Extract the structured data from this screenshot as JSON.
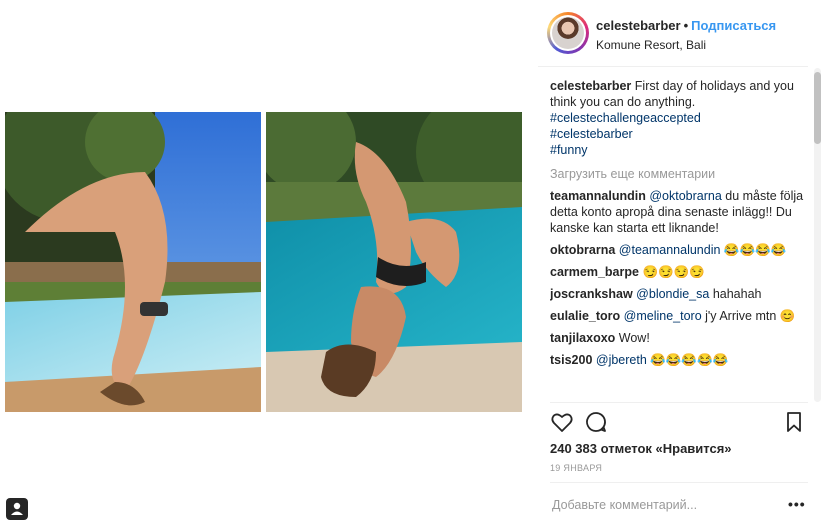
{
  "header": {
    "username": "celestebarber",
    "separator": "•",
    "follow_label": "Подписаться",
    "location": "Komune Resort, Bali"
  },
  "caption": {
    "username": "celestebarber",
    "text": "First day of holidays and you think you can do anything.",
    "hashtags": [
      "#celestechallengeaccepted",
      "#celestebarber",
      "#funny"
    ]
  },
  "load_more_label": "Загрузить еще комментарии",
  "comments": [
    {
      "user": "teamannalundin",
      "mention": "@oktobrarna",
      "text": " du måste följa detta konto apropå dina senaste inlägg!! Du kanske kan starta ett liknande!"
    },
    {
      "user": "oktobrarna",
      "mention": "@teamannalundin",
      "text": " 😂😂😂😂"
    },
    {
      "user": "carmem_barpe",
      "mention": "",
      "text": "😏😏😏😏"
    },
    {
      "user": "joscrankshaw",
      "mention": "@blondie_sa",
      "text": " hahahah"
    },
    {
      "user": "eulalie_toro",
      "mention": "@meline_toro",
      "text": " j'y Arrive mtn 😊"
    },
    {
      "user": "tanjilaxoxo",
      "mention": "",
      "text": "Wow!"
    },
    {
      "user": "tsis200",
      "mention": "@jbereth",
      "text": " 😂😂😂😂😂"
    }
  ],
  "likes": "240 383 отметок «Нравится»",
  "date": "19 ЯНВАРЯ",
  "add_comment_placeholder": "Добавьте комментарий...",
  "more_label": "•••",
  "icons": {
    "like": "heart-icon",
    "comment": "comment-bubble-icon",
    "save": "bookmark-icon",
    "user_tag": "user-tag-icon"
  }
}
